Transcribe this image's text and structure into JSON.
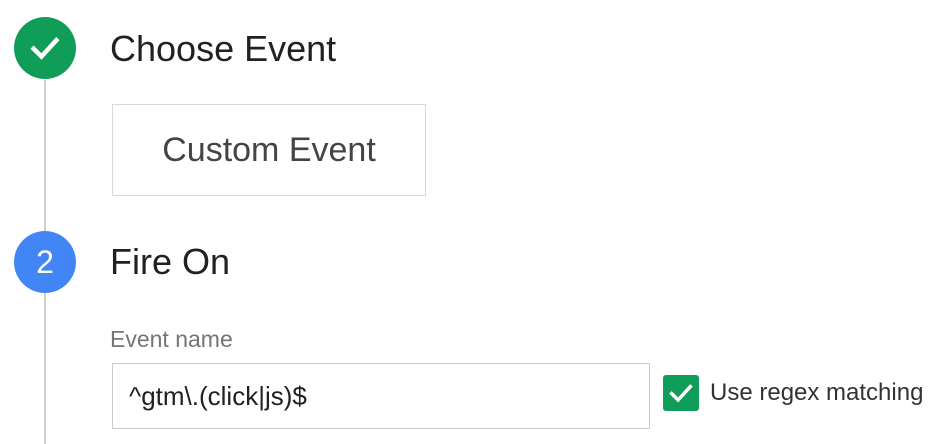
{
  "steps": [
    {
      "state": "done",
      "icon": "check-icon",
      "title": "Choose Event",
      "selected_event": "Custom Event"
    },
    {
      "state": "active",
      "number": "2",
      "title": "Fire On",
      "field": {
        "label": "Event name",
        "value": "^gtm\\.(click|js)$"
      },
      "regex_option": {
        "label": "Use regex matching",
        "checked": true,
        "icon": "check-icon"
      }
    }
  ],
  "colors": {
    "done": "#0f9d58",
    "active": "#4285f4",
    "checkbox": "#0f9d58",
    "rail": "#cfcfcf"
  }
}
